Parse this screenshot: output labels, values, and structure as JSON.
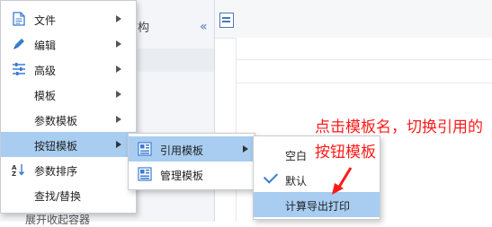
{
  "background": {
    "panel_title": "结构",
    "collapse_glyph": "«",
    "bottom_label": "展开收起容器"
  },
  "main_menu": {
    "items": [
      {
        "label": "文件",
        "icon": "file-icon",
        "has_submenu": true
      },
      {
        "label": "编辑",
        "icon": "pencil-icon",
        "has_submenu": true
      },
      {
        "label": "高级",
        "icon": "sliders-icon",
        "has_submenu": true
      },
      {
        "label": "模板",
        "icon": "",
        "has_submenu": true
      },
      {
        "label": "参数模板",
        "icon": "",
        "has_submenu": true
      },
      {
        "label": "按钮模板",
        "icon": "",
        "has_submenu": true,
        "active": true
      },
      {
        "label": "参数排序",
        "icon": "sort-az-icon",
        "has_submenu": false
      },
      {
        "label": "查找/替换",
        "icon": "",
        "has_submenu": false
      }
    ]
  },
  "submenu_button_template": {
    "items": [
      {
        "label": "引用模板",
        "icon": "template-grid-icon",
        "has_submenu": true,
        "active": true
      },
      {
        "label": "管理模板",
        "icon": "manage-grid-icon",
        "has_submenu": false
      }
    ]
  },
  "submenu_reference_template": {
    "items": [
      {
        "label": "空白",
        "checked": false
      },
      {
        "label": "默认",
        "checked": true
      },
      {
        "label": "计算导出打印",
        "checked": false,
        "active": true
      }
    ]
  },
  "annotation": {
    "text": "点击模板名，切换引用的按钮模板",
    "color": "#ff1a1a"
  },
  "colors": {
    "highlight": "#a8cdf1",
    "icon_blue": "#3b7bd0"
  }
}
